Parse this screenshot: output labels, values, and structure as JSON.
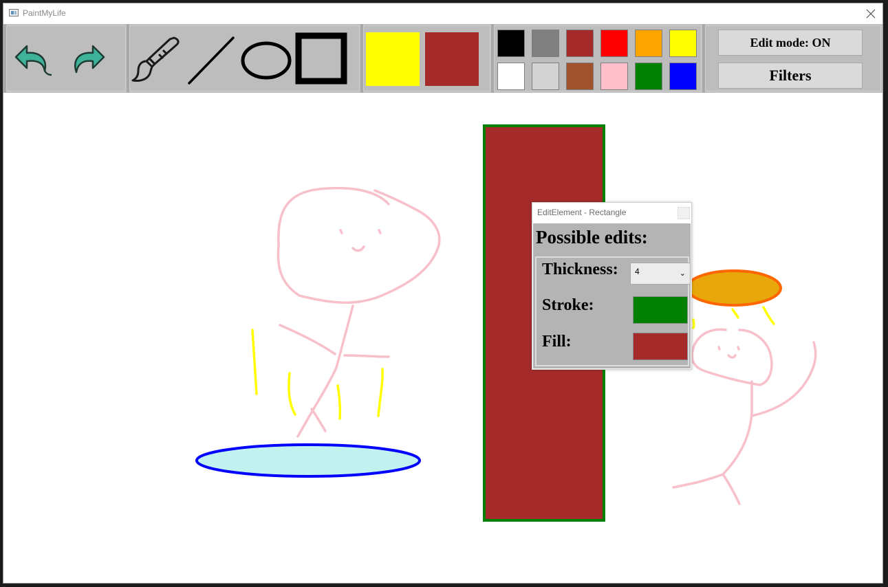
{
  "window": {
    "title": "PaintMyLife"
  },
  "toolbar": {
    "icons": [
      "undo-icon",
      "redo-icon",
      "brush-icon",
      "line-icon",
      "ellipse-icon",
      "rectangle-icon"
    ],
    "active_colors": {
      "primary": "#FFFF00",
      "secondary": "#A52A2A"
    },
    "palette": [
      "#000000",
      "#808080",
      "#A52A2A",
      "#FF0000",
      "#FFA500",
      "#FFFF00",
      "#FFFFFF",
      "#D3D3D3",
      "#A0522D",
      "#FFC0CB",
      "#008000",
      "#0000FF"
    ],
    "edit_mode_label": "Edit mode: ON",
    "filters_label": "Filters"
  },
  "dialog": {
    "title": "EditElement - Rectangle",
    "heading": "Possible edits:",
    "thickness_label": "Thickness:",
    "thickness_value": "4",
    "stroke_label": "Stroke:",
    "stroke_color": "#008000",
    "fill_label": "Fill:",
    "fill_color": "#A52A2A"
  },
  "canvas": {
    "shapes": [
      {
        "kind": "rectangle",
        "stroke": "#008000",
        "fill": "#A52A2A",
        "thickness": 4
      },
      {
        "kind": "ellipse",
        "stroke": "#0000FF",
        "fill": "#C2F2F0"
      },
      {
        "kind": "ellipse",
        "stroke": "#FF6600",
        "fill": "#E8A80C"
      },
      {
        "kind": "freehand",
        "stroke": "#FFC0CB"
      },
      {
        "kind": "freehand",
        "stroke": "#FFFF00"
      }
    ]
  }
}
